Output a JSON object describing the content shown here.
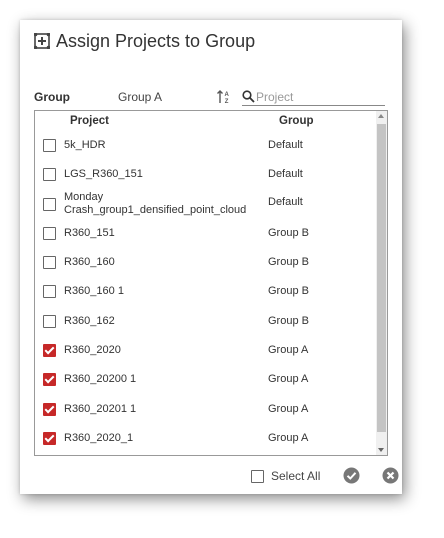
{
  "dialog": {
    "title": "Assign Projects to Group",
    "title_icon": "project-group-icon"
  },
  "filter": {
    "group_label": "Group",
    "group_value": "Group A",
    "sort_icon": "sort-az-icon",
    "search_icon": "search-icon",
    "search_placeholder": "Project",
    "search_value": ""
  },
  "table": {
    "headers": {
      "project": "Project",
      "group": "Group"
    },
    "rows": [
      {
        "project": "5k_HDR",
        "group": "Default",
        "checked": false
      },
      {
        "project": "LGS_R360_151",
        "group": "Default",
        "checked": false
      },
      {
        "project": "Monday\nCrash_group1_densified_point_cloud",
        "group": "Default",
        "checked": false
      },
      {
        "project": "R360_151",
        "group": "Group B",
        "checked": false
      },
      {
        "project": "R360_160",
        "group": "Group B",
        "checked": false
      },
      {
        "project": "R360_160 1",
        "group": "Group B",
        "checked": false
      },
      {
        "project": "R360_162",
        "group": "Group B",
        "checked": false
      },
      {
        "project": "R360_2020",
        "group": "Group A",
        "checked": true
      },
      {
        "project": "R360_20200 1",
        "group": "Group A",
        "checked": true
      },
      {
        "project": "R360_20201 1",
        "group": "Group A",
        "checked": true
      },
      {
        "project": "R360_2020_1",
        "group": "Group A",
        "checked": true
      }
    ]
  },
  "footer": {
    "select_all_label": "Select All",
    "select_all_checked": false,
    "ok_icon": "check-circle-icon",
    "cancel_icon": "close-circle-icon"
  },
  "colors": {
    "accent_checked": "#c62828",
    "icon_gray": "#777777"
  }
}
